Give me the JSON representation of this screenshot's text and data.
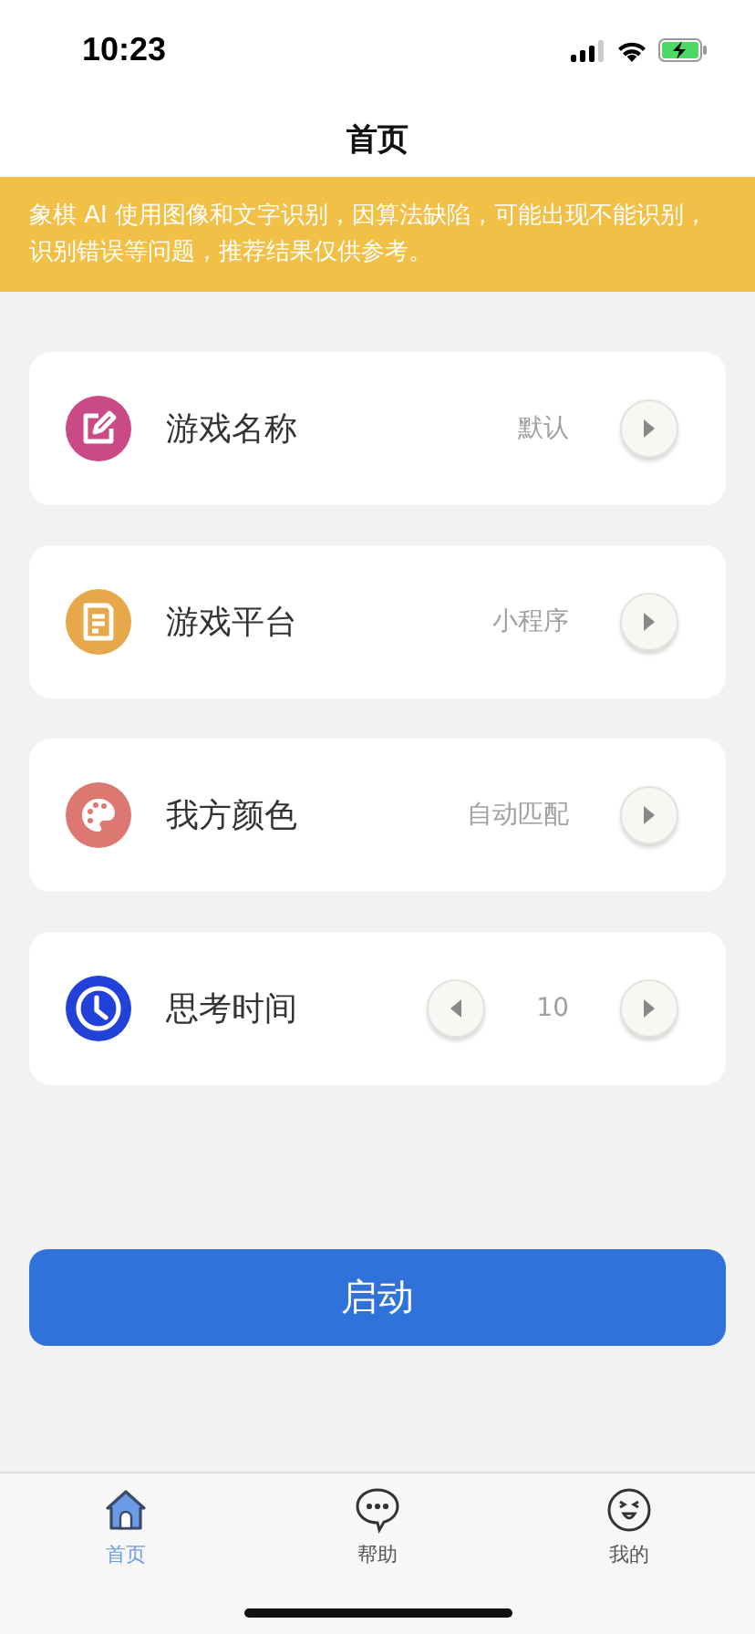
{
  "status_bar": {
    "time": "10:23"
  },
  "nav": {
    "title": "首页"
  },
  "notice": "象棋 AI 使用图像和文字识别，因算法缺陷，可能出现不能识别，识别错误等问题，推荐结果仅供参考。",
  "settings": [
    {
      "kind": "select",
      "color": "#c94a86",
      "label": "游戏名称",
      "value": "默认"
    },
    {
      "kind": "select",
      "color": "#e6a84a",
      "label": "游戏平台",
      "value": "小程序"
    },
    {
      "kind": "select",
      "color": "#dc7771",
      "label": "我方颜色",
      "value": "自动匹配"
    },
    {
      "kind": "stepper",
      "color": "#2141d9",
      "label": "思考时间",
      "value": "10"
    }
  ],
  "start_button": "启动",
  "tabs": [
    {
      "label": "首页",
      "selected": true
    },
    {
      "label": "帮助",
      "selected": false
    },
    {
      "label": "我的",
      "selected": false
    }
  ]
}
